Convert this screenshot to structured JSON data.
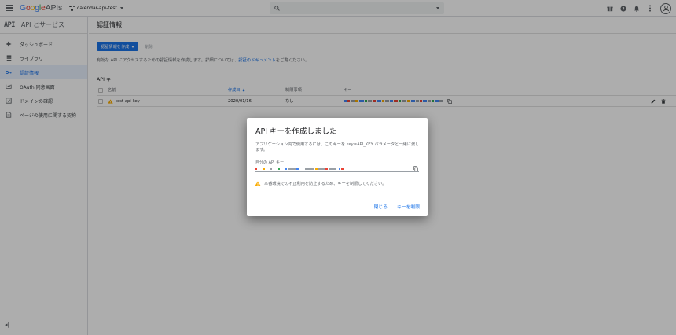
{
  "header": {
    "logo_google": "Google",
    "logo_apis": "APIs",
    "project_name": "calendar-api-test",
    "search_placeholder": ""
  },
  "colors": {
    "accent": "#1a73e8",
    "warning": "#f9ab00",
    "overlay": "rgba(0,0,0,0.32)"
  },
  "sidebar": {
    "badge": "API",
    "title": "API とサービス",
    "items": [
      {
        "label": "ダッシュボード",
        "icon": "dashboard-icon"
      },
      {
        "label": "ライブラリ",
        "icon": "library-icon"
      },
      {
        "label": "認証情報",
        "icon": "key-icon",
        "active": true
      },
      {
        "label": "OAuth 同意画面",
        "icon": "oauth-consent-icon"
      },
      {
        "label": "ドメインの確認",
        "icon": "domain-check-icon"
      },
      {
        "label": "ページの使用に関する契約",
        "icon": "page-agreement-icon"
      }
    ],
    "collapse_label": "◂|"
  },
  "main": {
    "title": "認証情報",
    "create_button": "認証情報を作成",
    "delete_button": "削除",
    "info_text": "有効な API にアクセスするための認証情報を作成します。詳細については、",
    "info_link": "認証のドキュメント",
    "info_suffix": "をご覧ください。",
    "section_title": "API キー",
    "table": {
      "headers": {
        "name": "名前",
        "created": "作成日",
        "restriction": "制限事項",
        "key": "キー"
      },
      "rows": [
        {
          "name": "test-api-key",
          "created": "2020/01/16",
          "restriction": "なし"
        }
      ]
    }
  },
  "dialog": {
    "title": "API キーを作成しました",
    "body": "アプリケーション内で使用するには、このキーを key=API_KEY パラメータと一緒に渡します。",
    "field_label": "自分の API キー",
    "warning": "本番環境での不正利用を防止するため、キーを制限してください。",
    "close_button": "閉じる",
    "restrict_button": "キーを制限"
  }
}
